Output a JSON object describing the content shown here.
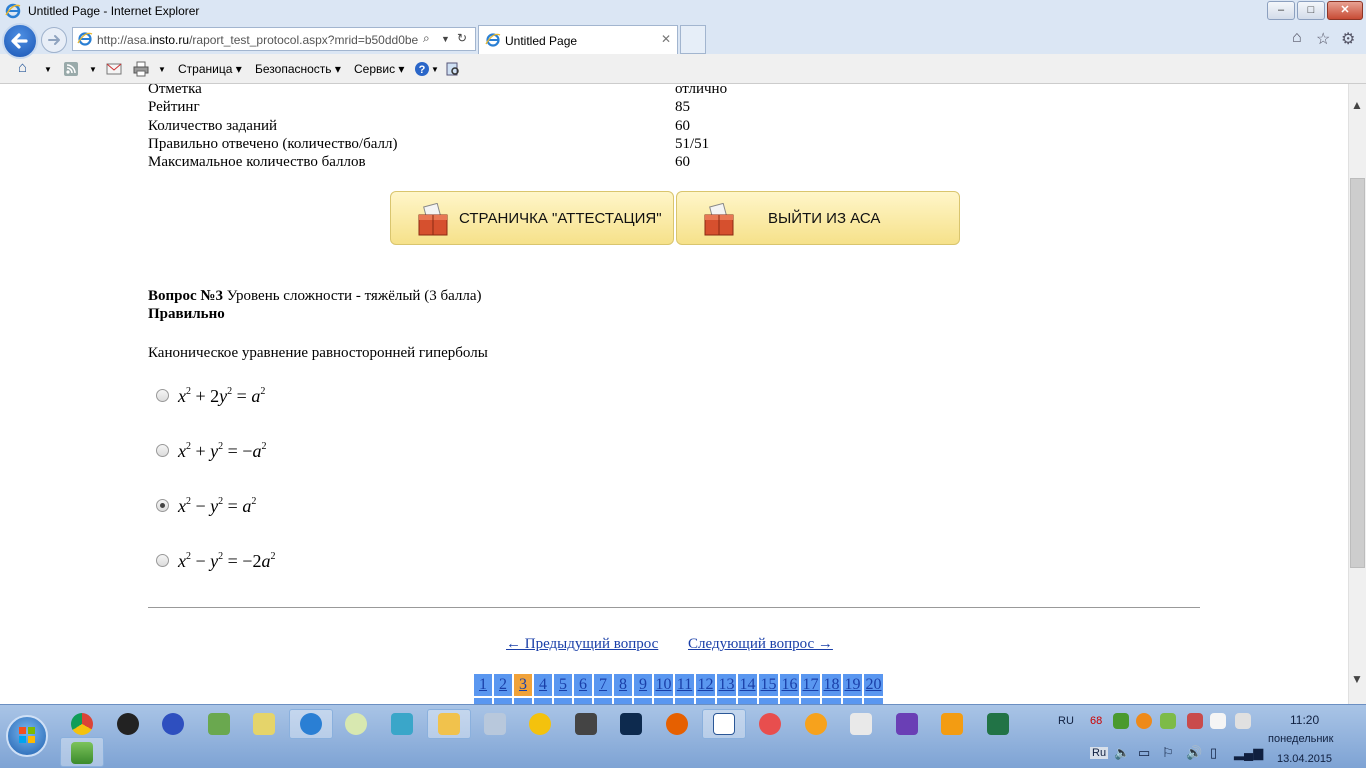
{
  "window": {
    "title": "Untitled Page - Internet Explorer",
    "controls": {
      "minimize": "–",
      "maximize": "□",
      "close": "✕"
    }
  },
  "browser": {
    "url_prefix": "http://asa.",
    "url_domain": "insto.ru",
    "url_path": "/raport_test_protocol.aspx?mrid=b50dd0be",
    "tab_label": "Untitled Page"
  },
  "command_bar": {
    "page_menu": "Страница",
    "security_menu": "Безопасность",
    "service_menu": "Сервис"
  },
  "summary": [
    {
      "label": "Отметка",
      "value": "отлично"
    },
    {
      "label": "Рейтинг",
      "value": "85"
    },
    {
      "label": "Количество заданий",
      "value": "60"
    },
    {
      "label": "Правильно отвечено (количество/балл)",
      "value": "51/51"
    },
    {
      "label": "Максимальное количество баллов",
      "value": "60"
    }
  ],
  "buttons": {
    "attestation": "СТРАНИЧКА \"АТТЕСТАЦИЯ\"",
    "exit": "ВЫЙТИ ИЗ АСА"
  },
  "question": {
    "number_label": "Вопрос №3",
    "difficulty": "Уровень сложности - тяжёлый (3 балла)",
    "status": "Правильно",
    "text": "Каноническое уравнение равносторонней гиперболы",
    "selected_index": 2,
    "options": [
      {
        "a": "x",
        "p1": "2",
        "op": " + 2",
        "b": "y",
        "p2": "2",
        "eq": " = ",
        "c": "a",
        "p3": "2"
      },
      {
        "a": "x",
        "p1": "2",
        "op": " + ",
        "b": "y",
        "p2": "2",
        "eq": " = −",
        "c": "a",
        "p3": "2"
      },
      {
        "a": "x",
        "p1": "2",
        "op": " − ",
        "b": "y",
        "p2": "2",
        "eq": " = ",
        "c": "a",
        "p3": "2"
      },
      {
        "a": "x",
        "p1": "2",
        "op": " − ",
        "b": "y",
        "p2": "2",
        "eq": " = −2",
        "c": "a",
        "p3": "2"
      }
    ]
  },
  "navigation": {
    "prev": "← Предыдущий вопрос",
    "next": "Следующий вопрос →"
  },
  "pager": {
    "current": 3,
    "pages": [
      "1",
      "2",
      "3",
      "4",
      "5",
      "6",
      "7",
      "8",
      "9",
      "10",
      "11",
      "12",
      "13",
      "14",
      "15",
      "16",
      "17",
      "18",
      "19",
      "20"
    ]
  },
  "taskbar": {
    "language": "RU",
    "language_small": "Ru",
    "tray_badge": "68",
    "time": "11:20",
    "day": "понедельник",
    "date": "13.04.2015"
  }
}
